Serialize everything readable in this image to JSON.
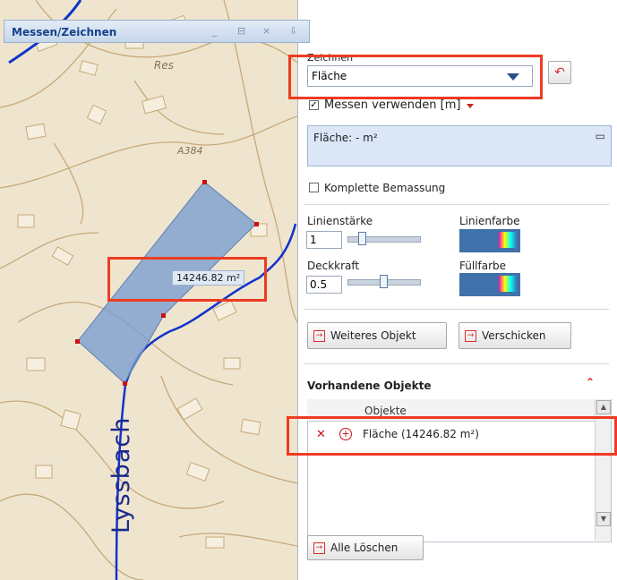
{
  "map": {
    "area_label": "14246.82 m²",
    "river_label": "Lyssbach",
    "place_label_1": "Res",
    "place_label_2": "A384"
  },
  "panel": {
    "title": "Messen/Zeichnen",
    "window_buttons": [
      "_",
      "⊟",
      "×",
      "⇩"
    ],
    "draw_section_label": "Zeichnen",
    "draw_select_value": "Fläche",
    "use_measure_label": "Messen verwenden",
    "unit_label": "[m]",
    "measure_result": "Fläche: - m²",
    "complete_dimension_label": "Komplette Bemassung",
    "line_width_label": "Linienstärke",
    "line_width_value": "1",
    "line_color_label": "Linienfarbe",
    "opacity_label": "Deckkraft",
    "opacity_value": "0.5",
    "fill_color_label": "Füllfarbe",
    "more_object_button": "Weiteres Objekt",
    "send_button": "Verschicken",
    "existing_objects_title": "Vorhandene Objekte",
    "objects_column": "Objekte",
    "objects": [
      {
        "label": "Fläche (14246.82 m²)"
      }
    ],
    "delete_all_button": "Alle Löschen"
  },
  "colors": {
    "accent_title": "#15428b",
    "polygon_fill": "#7a9fcf",
    "callout": "#ee3b22",
    "river": "#1133cc"
  }
}
